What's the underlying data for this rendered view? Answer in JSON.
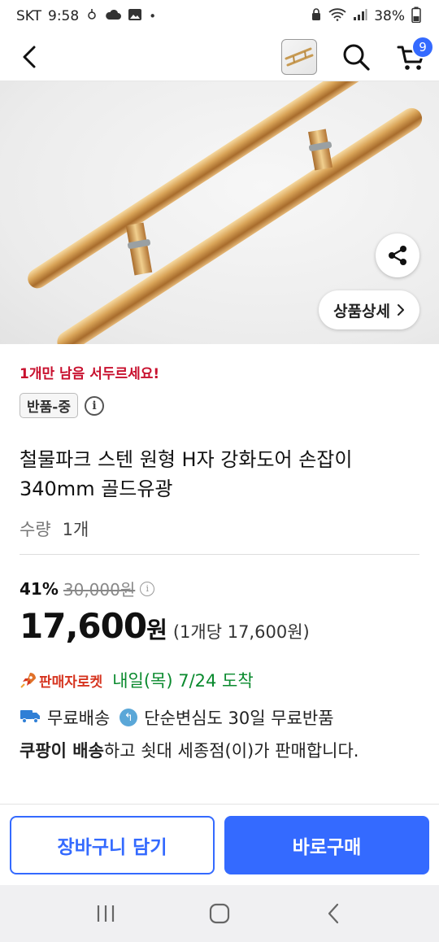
{
  "status_bar": {
    "carrier": "SKT",
    "time": "9:58",
    "battery": "38%"
  },
  "header": {
    "cart_count": "9"
  },
  "product_image": {
    "detail_button_label": "상품상세"
  },
  "info": {
    "urgency": "1개만 남음 서두르세요!",
    "return_badge": "반품-중",
    "title": "철물파크 스텐 원형 H자 강화도어 손잡이 340mm 골드유광",
    "quantity_label": "수량",
    "quantity_value": "1개",
    "discount": "41%",
    "original_price": "30,000원",
    "price": "17,600",
    "price_unit": "원",
    "unit_price": "(1개당 17,600원)",
    "rocket_label": "판매자로켓",
    "arrival": "내일(목) 7/24 도착",
    "free_shipping": "무료배송",
    "free_return": "단순변심도 30일 무료반품",
    "seller_bold": "쿠팡이 배송",
    "seller_rest": "하고 쇳대 세종점(이)가 판매합니다."
  },
  "bottom_bar": {
    "cart_button": "장바구니 담기",
    "buy_button": "바로구매"
  },
  "colors": {
    "accent": "#346aff",
    "urgent": "#c8102e",
    "arrival": "#0a8a2e",
    "rocket": "#d6341f"
  }
}
